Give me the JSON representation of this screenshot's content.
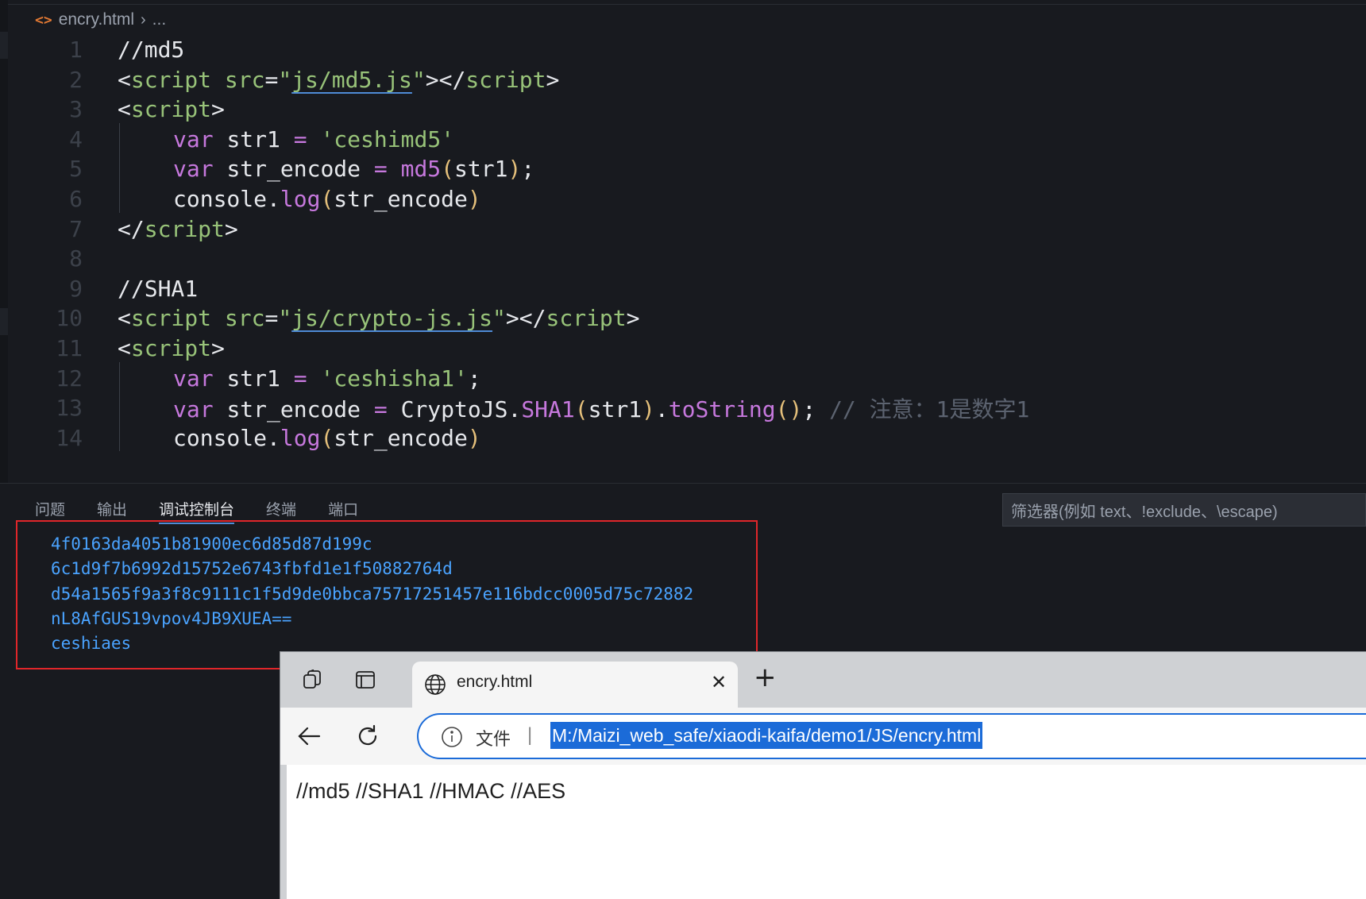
{
  "editor": {
    "breadcrumb": {
      "file": "encry.html",
      "more": "..."
    },
    "lines": [
      {
        "num": "1",
        "parts": [
          [
            "cmt-white",
            "//md5"
          ]
        ]
      },
      {
        "num": "2",
        "parts": [
          [
            "tag",
            "<"
          ],
          [
            "tagname",
            "script "
          ],
          [
            "attr",
            "src"
          ],
          [
            "tag",
            "="
          ],
          [
            "str",
            "\""
          ],
          [
            "strlink",
            "js/md5.js"
          ],
          [
            "str",
            "\""
          ],
          [
            "tag",
            "></"
          ],
          [
            "tagname",
            "script"
          ],
          [
            "tag",
            ">"
          ]
        ]
      },
      {
        "num": "3",
        "parts": [
          [
            "tag",
            "<"
          ],
          [
            "tagname",
            "script"
          ],
          [
            "tag",
            ">"
          ]
        ]
      },
      {
        "num": "4",
        "indent": true,
        "parts": [
          [
            "kw",
            "var "
          ],
          [
            "plain",
            "str1 "
          ],
          [
            "op",
            "= "
          ],
          [
            "str",
            "'ceshimd5'"
          ]
        ]
      },
      {
        "num": "5",
        "indent": true,
        "parts": [
          [
            "kw",
            "var "
          ],
          [
            "plain",
            "str_encode "
          ],
          [
            "op",
            "= "
          ],
          [
            "fn",
            "md5"
          ],
          [
            "paren",
            "("
          ],
          [
            "plain",
            "str1"
          ],
          [
            "paren",
            ")"
          ],
          [
            "plain",
            ";"
          ]
        ]
      },
      {
        "num": "6",
        "indent": true,
        "parts": [
          [
            "plain",
            "console."
          ],
          [
            "fn",
            "log"
          ],
          [
            "paren",
            "("
          ],
          [
            "plain",
            "str_encode"
          ],
          [
            "paren",
            ")"
          ]
        ]
      },
      {
        "num": "7",
        "parts": [
          [
            "tag",
            "</"
          ],
          [
            "tagname",
            "script"
          ],
          [
            "tag",
            ">"
          ]
        ]
      },
      {
        "num": "8",
        "parts": []
      },
      {
        "num": "9",
        "parts": [
          [
            "cmt-white",
            "//SHA1"
          ]
        ]
      },
      {
        "num": "10",
        "parts": [
          [
            "tag",
            "<"
          ],
          [
            "tagname",
            "script "
          ],
          [
            "attr",
            "src"
          ],
          [
            "tag",
            "="
          ],
          [
            "str",
            "\""
          ],
          [
            "strlink",
            "js/crypto-js.js"
          ],
          [
            "str",
            "\""
          ],
          [
            "tag",
            "></"
          ],
          [
            "tagname",
            "script"
          ],
          [
            "tag",
            ">"
          ]
        ]
      },
      {
        "num": "11",
        "parts": [
          [
            "tag",
            "<"
          ],
          [
            "tagname",
            "script"
          ],
          [
            "tag",
            ">"
          ]
        ]
      },
      {
        "num": "12",
        "indent": true,
        "parts": [
          [
            "kw",
            "var "
          ],
          [
            "plain",
            "str1 "
          ],
          [
            "op",
            "= "
          ],
          [
            "str",
            "'ceshisha1'"
          ],
          [
            "plain",
            ";"
          ]
        ]
      },
      {
        "num": "13",
        "indent": true,
        "parts": [
          [
            "kw",
            "var "
          ],
          [
            "plain",
            "str_encode "
          ],
          [
            "op",
            "= "
          ],
          [
            "plain",
            "CryptoJS."
          ],
          [
            "fn",
            "SHA1"
          ],
          [
            "paren",
            "("
          ],
          [
            "plain",
            "str1"
          ],
          [
            "paren",
            ")"
          ],
          [
            "plain",
            "."
          ],
          [
            "fn",
            "toString"
          ],
          [
            "paren",
            "()"
          ],
          [
            "plain",
            "; "
          ],
          [
            "cmt",
            "// 注意：1是数字1"
          ]
        ]
      },
      {
        "num": "14",
        "indent": true,
        "parts": [
          [
            "plain",
            "console."
          ],
          [
            "fn",
            "log"
          ],
          [
            "paren",
            "("
          ],
          [
            "plain",
            "str_encode"
          ],
          [
            "paren",
            ")"
          ]
        ]
      }
    ]
  },
  "panel": {
    "tabs": [
      {
        "label": "问题",
        "active": false
      },
      {
        "label": "输出",
        "active": false
      },
      {
        "label": "调试控制台",
        "active": true
      },
      {
        "label": "终端",
        "active": false
      },
      {
        "label": "端口",
        "active": false
      }
    ],
    "filter_placeholder": "筛选器(例如 text、!exclude、\\escape)",
    "console_lines": [
      "4f0163da4051b81900ec6d85d87d199c",
      "6c1d9f7b6992d15752e6743fbfd1e1f50882764d",
      "d54a1565f9a3f8c9111c1f5d9de0bbca75717251457e116bdcc0005d75c72882",
      "nL8AfGUS19vpov4JB9XUEA==",
      "ceshiaes"
    ],
    "highlight_color": "#e0262a"
  },
  "browser": {
    "tab_title": "encry.html",
    "address_scheme": "文件",
    "address_separator": "|",
    "url": "M:/Maizi_web_safe/xiaodi-kaifa/demo1/JS/encry.html",
    "page_text": "//md5 //SHA1 //HMAC //AES",
    "accent_color": "#1b6bd8"
  }
}
